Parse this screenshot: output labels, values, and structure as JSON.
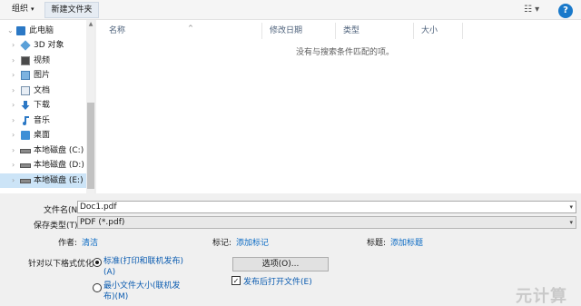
{
  "toolbar": {
    "organize_label": "组织",
    "organize_caret": "▾",
    "new_folder_label": "新建文件夹",
    "view_glyph": "☷ ▾",
    "help_glyph": "?"
  },
  "nav": {
    "items": [
      {
        "label": "此电脑",
        "chev": "⌄"
      },
      {
        "label": "3D 对象",
        "chev": "›"
      },
      {
        "label": "视频",
        "chev": "›"
      },
      {
        "label": "图片",
        "chev": "›"
      },
      {
        "label": "文档",
        "chev": "›"
      },
      {
        "label": "下载",
        "chev": "›"
      },
      {
        "label": "音乐",
        "chev": "›"
      },
      {
        "label": "桌面",
        "chev": "›"
      },
      {
        "label": "本地磁盘 (C:)",
        "chev": "›"
      },
      {
        "label": "本地磁盘 (D:)",
        "chev": "›"
      },
      {
        "label": "本地磁盘 (E:)",
        "chev": "›"
      }
    ],
    "scroll_up": "▲"
  },
  "columns": {
    "name": "名称",
    "modified": "修改日期",
    "type": "类型",
    "size": "大小",
    "sort_arrow": "^"
  },
  "empty_message": "没有与搜索条件匹配的项。",
  "form": {
    "filename_label": "文件名(N):",
    "filename_value": "Doc1.pdf",
    "filetype_label": "保存类型(T):",
    "filetype_value": "PDF (*.pdf)",
    "author_label": "作者:",
    "author_value": "清洁",
    "tags_label": "标记:",
    "tags_value": "添加标记",
    "title_label": "标题:",
    "title_value": "添加标题",
    "optimize_label": "针对以下格式优化:",
    "radio1_line1": "标准(打印和联机发布)",
    "radio1_line2": "(A)",
    "radio2_line1": "最小文件大小(联机发",
    "radio2_line2": "布)(M)",
    "options_button": "选项(O)...",
    "open_after_label": "发布后打开文件(E)",
    "caret": "▾",
    "check": "✓"
  },
  "watermark": "元计算"
}
